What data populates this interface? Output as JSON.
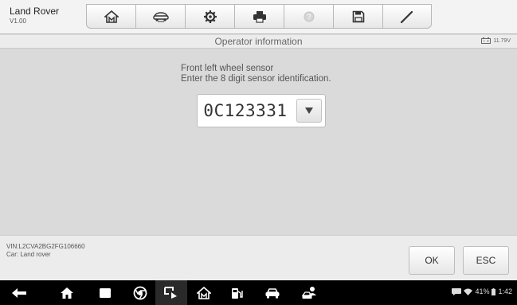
{
  "header": {
    "vehicle_make": "Land Rover",
    "version": "V1.00",
    "tools": [
      {
        "icon": "home-icon"
      },
      {
        "icon": "vehicle-swap-icon"
      },
      {
        "icon": "settings-gear-icon"
      },
      {
        "icon": "printer-icon"
      },
      {
        "icon": "help-icon"
      },
      {
        "icon": "save-icon"
      },
      {
        "icon": "pen-icon"
      }
    ]
  },
  "titlebar": {
    "title": "Operator information",
    "battery_voltage": "11.79V"
  },
  "main": {
    "message_line1": "Front left wheel sensor",
    "message_line2": "Enter the 8 digit sensor identification.",
    "sensor_id_value": "0C123331"
  },
  "footer": {
    "vin": "VIN:L2CVA2BG2FG106660",
    "car": "Car: Land rover",
    "ok_label": "OK",
    "esc_label": "ESC"
  },
  "navbar": {
    "battery_percent": "41%",
    "time": "1:42"
  },
  "colors": {
    "background": "#d9d9d9",
    "toolbar": "#f3f3f3",
    "navbar": "#000000"
  }
}
